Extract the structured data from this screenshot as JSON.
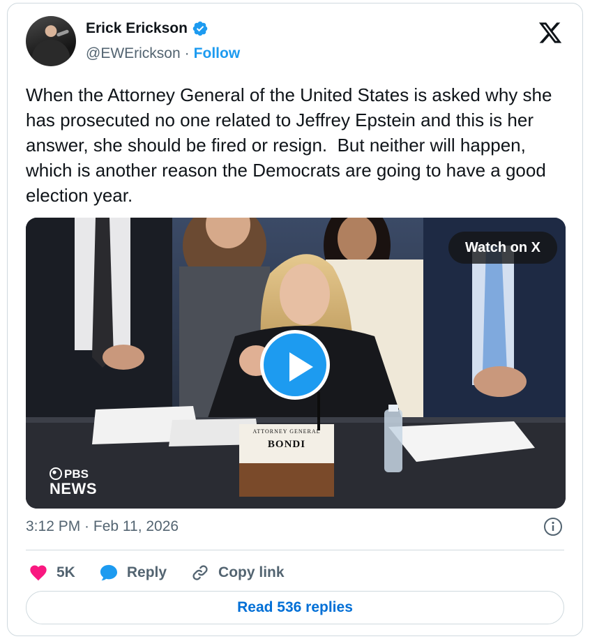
{
  "author": {
    "name": "Erick Erickson",
    "handle": "@EWErickson",
    "separator": "·",
    "follow_label": "Follow",
    "verified_icon": "verified-badge-icon"
  },
  "tweet": {
    "text": "When the Attorney General of the United States is asked why she has prosecuted no one related to Jeffrey Epstein and this is her answer, she should be fired or resign.  But neither will happen, which is another reason the Democrats are going to have a good election year."
  },
  "media": {
    "watch_label": "Watch on X",
    "watermark_line1": "PBS",
    "watermark_line2": "NEWS",
    "placard_title": "ATTORNEY GENERAL",
    "placard_name": "BONDI",
    "play_icon": "play-icon"
  },
  "meta": {
    "timestamp": "3:12 PM · Feb 11, 2026"
  },
  "actions": {
    "like_count": "5K",
    "reply_label": "Reply",
    "copy_label": "Copy link"
  },
  "footer": {
    "read_replies_label": "Read 536 replies"
  },
  "colors": {
    "accent": "#1d9bf0",
    "like": "#f91880",
    "link": "#006fd6",
    "text": "#0f1419",
    "muted": "#536471",
    "border": "#cfd9de"
  }
}
